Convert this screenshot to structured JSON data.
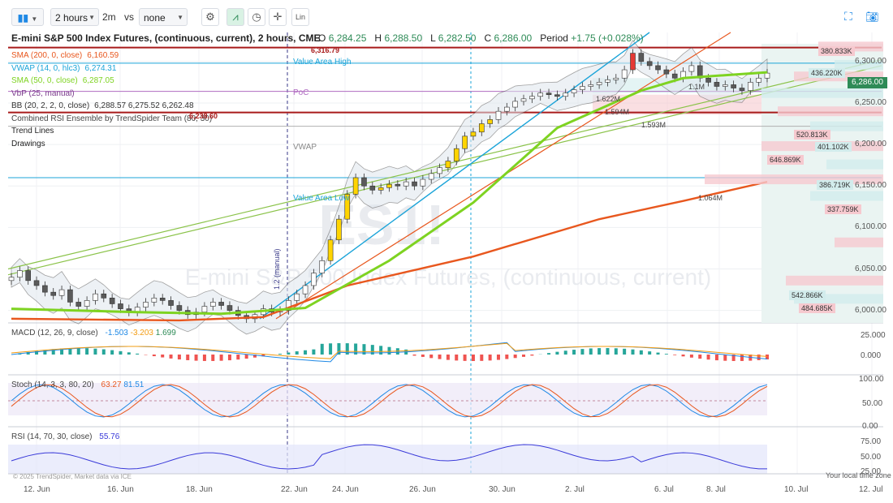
{
  "toolbar": {
    "interval": "2 hours",
    "interval_short": "2m",
    "vs_label": "vs",
    "compare": "none",
    "scale_label": "Lin"
  },
  "header": {
    "title": "E-mini S&P 500 Index Futures, (continuous, current), 2 hours, CME",
    "open_label": "O",
    "open": "6,284.25",
    "high_label": "H",
    "high": "6,288.50",
    "low_label": "L",
    "low": "6,282.50",
    "close_label": "C",
    "close": "6,286.00",
    "period_label": "Period",
    "period_change": "+1.75 (+0.028%)"
  },
  "legend": [
    {
      "label": "SMA (200, 0, close)",
      "value": "6,160.59",
      "color": "#e8571e"
    },
    {
      "label": "VWAP (14, 0, hlc3)",
      "value": "6,274.31",
      "color": "#1ba4d9"
    },
    {
      "label": "SMA (50, 0, close)",
      "value": "6,287.05",
      "color": "#7ed321"
    },
    {
      "label": "VbP (25, manual)",
      "value": "",
      "color": "#7a3a8c"
    },
    {
      "label": "BB (20, 2, 2, 0, close)",
      "value": "6,288.57  6,275.52  6,262.48",
      "color": "#333333"
    },
    {
      "label": "Combined RSI Ensemble by TrendSpider Team (80, 30)",
      "value": "",
      "color": "#444444"
    },
    {
      "label": "Trend Lines",
      "value": "",
      "color": "#222222"
    },
    {
      "label": "Drawings",
      "value": "",
      "color": "#222222"
    }
  ],
  "annotations": {
    "value_area_high": "Value Area High",
    "poc": "PoC",
    "vwap": "VWAP",
    "value_area_low": "Value Area Low",
    "level_high": "6,316.79",
    "level_low": "6,238.60",
    "vol_labels": [
      "1.622M",
      "1.594M",
      "1.593M",
      "1.1M",
      "1.064M"
    ],
    "watermark_symbol": "ES1!",
    "watermark_name": "E-mini S&P 500 Index Futures, (continuous, current)",
    "manual_label": "1.2 (manual)",
    "copyright": "© 2025 TrendSpider, Market data via ICE",
    "timezone": "Your local time zone"
  },
  "price_axis": {
    "ticks": [
      "6,300.00",
      "6,250.00",
      "6,200.00",
      "6,150.00",
      "6,100.00",
      "6,050.00",
      "6,000.00"
    ],
    "current": "6,286.00",
    "vol_boxes": [
      "380.833K",
      "436.220K",
      "520.813K",
      "401.102K",
      "646.869K",
      "386.719K",
      "337.759K",
      "542.866K",
      "484.685K"
    ]
  },
  "macd": {
    "label": "MACD (12, 26, 9, close)",
    "v1": "-1.503",
    "v2": "-3.203",
    "v3": "1.699",
    "ticks": [
      "25.000",
      "0.000"
    ]
  },
  "stoch": {
    "label": "Stoch (14, 3, 3, 80, 20)",
    "v1": "63.27",
    "v2": "81.51",
    "ticks": [
      "100.00",
      "50.00",
      "0.00"
    ]
  },
  "rsi": {
    "label": "RSI (14, 70, 30, close)",
    "v1": "55.76",
    "ticks": [
      "75.00",
      "50.00",
      "25.00"
    ]
  },
  "time_axis": [
    "12. Jun",
    "16. Jun",
    "18. Jun",
    "22. Jun",
    "24. Jun",
    "26. Jun",
    "30. Jun",
    "2. Jul",
    "6. Jul",
    "8. Jul",
    "10. Jul",
    "12. Jul"
  ],
  "colors": {
    "sma200": "#e8571e",
    "sma50": "#7ed321",
    "vwap": "#1ba4d9",
    "bb": "#333333",
    "resistance": "#a81a1a",
    "poc": "#b06cc1",
    "up": "#2e8b57",
    "down": "#e53935"
  },
  "chart_data": {
    "type": "candlestick",
    "instrument": "E-mini S&P 500 Index Futures, (continuous, current), 2 hours, CME",
    "price_range": [
      5985,
      6335
    ],
    "levels": {
      "resistance": 6316.79,
      "support": 6238.6,
      "value_area_high": 6298,
      "poc": 6264,
      "vwap": 6222,
      "value_area_low": 6160
    },
    "closes": [
      6040,
      6048,
      6036,
      6030,
      6022,
      6018,
      6025,
      6010,
      6005,
      6012,
      6020,
      6015,
      6008,
      6002,
      5998,
      6004,
      6010,
      6015,
      6012,
      6006,
      6000,
      5995,
      5998,
      6005,
      6010,
      6006,
      6000,
      5994,
      5990,
      5995,
      6002,
      5998,
      6000,
      6012,
      6020,
      6030,
      6045,
      6060,
      6085,
      6110,
      6140,
      6160,
      6150,
      6145,
      6148,
      6152,
      6150,
      6155,
      6150,
      6158,
      6165,
      6172,
      6180,
      6195,
      6210,
      6215,
      6225,
      6230,
      6240,
      6245,
      6252,
      6255,
      6258,
      6262,
      6260,
      6258,
      6262,
      6266,
      6270,
      6272,
      6275,
      6278,
      6280,
      6290,
      6310,
      6300,
      6295,
      6290,
      6285,
      6280,
      6288,
      6295,
      6280,
      6275,
      6270,
      6272,
      6268,
      6265,
      6275,
      6280,
      6286
    ],
    "sma200": [
      [
        0,
        5990
      ],
      [
        20,
        5988
      ],
      [
        30,
        5992
      ],
      [
        40,
        6030
      ],
      [
        55,
        6065
      ],
      [
        70,
        6110
      ],
      [
        80,
        6132
      ],
      [
        90,
        6155
      ]
    ],
    "sma50": [
      [
        0,
        6002
      ],
      [
        15,
        5998
      ],
      [
        25,
        5996
      ],
      [
        35,
        6003
      ],
      [
        45,
        6060
      ],
      [
        55,
        6130
      ],
      [
        65,
        6220
      ],
      [
        75,
        6265
      ],
      [
        80,
        6280
      ],
      [
        90,
        6287
      ]
    ],
    "macd": {
      "label": "MACD (12, 26, 9, close)",
      "values": [
        -1.503,
        -3.203,
        1.699
      ]
    },
    "stoch": {
      "label": "Stoch (14, 3, 3, 80, 20)",
      "values": [
        63.27,
        81.51
      ]
    },
    "rsi": {
      "label": "RSI (14, 70, 30, close)",
      "value": 55.76
    },
    "x_ticks": [
      "12. Jun",
      "16. Jun",
      "18. Jun",
      "22. Jun",
      "24. Jun",
      "26. Jun",
      "30. Jun",
      "2. Jul",
      "6. Jul",
      "8. Jul",
      "10. Jul",
      "12. Jul"
    ],
    "y_ticks": [
      6300,
      6250,
      6200,
      6150,
      6100,
      6050,
      6000
    ],
    "grid": true
  }
}
